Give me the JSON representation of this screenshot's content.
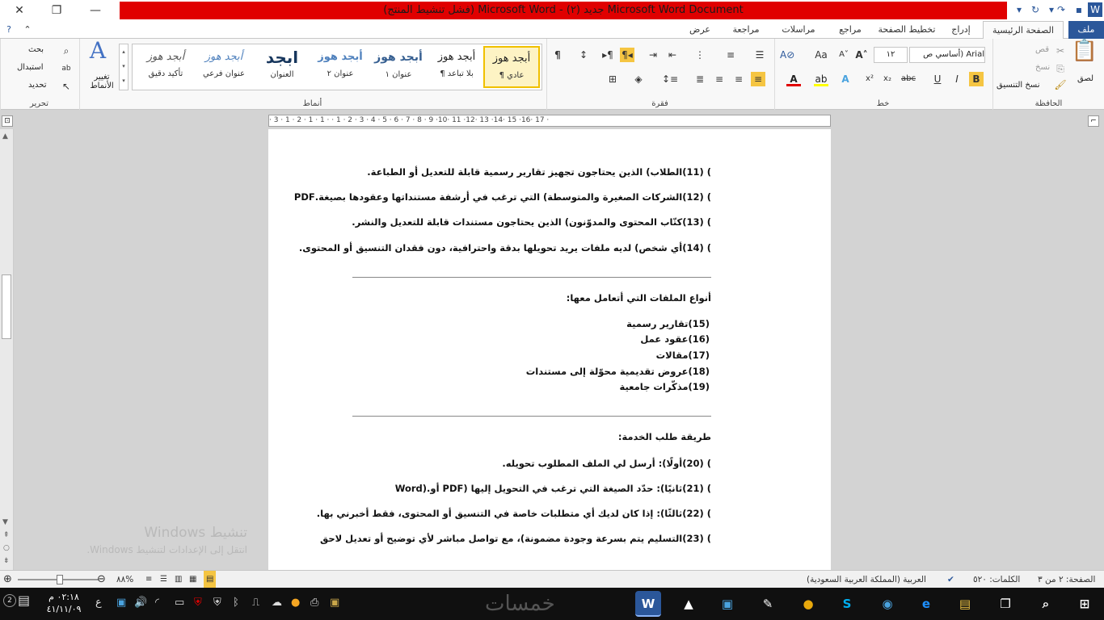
{
  "window": {
    "title": "Microsoft Word Document جديد (٢) - Microsoft Word (فشل تنشيط المنتج)"
  },
  "tabs": [
    "ملف",
    "الصفحة الرئيسية",
    "إدراج",
    "تخطيط الصفحة",
    "مراجع",
    "مراسلات",
    "مراجعة",
    "عرض"
  ],
  "ribbon": {
    "clipboard": {
      "label": "الحافظة",
      "paste": "لصق",
      "cut": "قص",
      "copy": "نسخ",
      "format_painter": "نسخ التنسيق"
    },
    "font": {
      "label": "خط",
      "name": "Arial (أساسي ص",
      "size": "١٢"
    },
    "paragraph": {
      "label": "فقرة"
    },
    "styles": {
      "label": "أنماط",
      "change_styles": "تغيير الأنماط",
      "sample": "أبجد هوز",
      "sample_title": "ابجد",
      "items": [
        "¶ عادي",
        "¶ بلا تباعد",
        "عنوان ١",
        "عنوان ٢",
        "العنوان",
        "عنوان فرعي",
        "تأكيد دقيق"
      ]
    },
    "editing": {
      "label": "تحرير",
      "find": "بحث",
      "replace": "استبدال",
      "select": "تحديد"
    }
  },
  "ruler": {
    "text": "· 3 · 1 · 2 · 1 · 1 ·   · 1 · 2 · 3 · 4 · 5 · 6 · 7 · 8 · 9 ·10· 11 ·12· 13 ·14· 15 ·16· 17 ·"
  },
  "document": {
    "paras_a": [
      ") (11)الطلاب) الذين يحتاجون تجهيز تقارير رسمية قابلة للتعديل أو الطباعة.",
      ") (12)الشركات الصغيرة والمتوسطة) التي ترغب في أرشفة مستنداتها وعقودها بصيغة.PDF",
      ") (13)كتّاب المحتوى والمدوّنون) الذين يحتاجون مستندات قابلة للتعديل والنشر.",
      ") (14)أي شخص) لديه ملفات يريد تحويلها بدقة واحترافية، دون فقدان التنسيق أو المحتوى."
    ],
    "heading_types": "أنواع الملفات التي أتعامل معها:",
    "types": [
      "(15)تقارير رسمية",
      "(16)عقود عمل",
      "(17)مقالات",
      "(18)عروض تقديمية محوّلة إلى مستندات",
      "(19)مذكّرات جامعية"
    ],
    "heading_request": "طريقة طلب الخدمة:",
    "paras_b": [
      ") (20)أولًا): أرسل لي الملف المطلوب تحويله.",
      ") (21)ثانيًا): حدّد الصيغة التي ترغب في التحويل إليها (PDF أو.(Word",
      ") (22)ثالثًا): إذا كان لديك أي متطلبات خاصة في التنسيق أو المحتوى، فقط أخبرني بها.",
      ") (23)التسليم يتم بسرعة وجودة مضمونة)، مع تواصل مباشر لأي توضيح أو تعديل لاحق"
    ]
  },
  "watermark": {
    "line1": "تنشيط Windows",
    "line2": "انتقل إلى الإعدادات لتنشيط Windows."
  },
  "status": {
    "page": "الصفحة: ٢ من ٣",
    "words": "الكلمات: ٥٢٠",
    "language": "العربية (المملكة العربية السعودية)",
    "zoom": "٨٨%"
  },
  "taskbar": {
    "time": "٠٢:١٨ م",
    "date": "٤١/١١/٠٩",
    "keyboard": "ع",
    "apps": [
      "W",
      "▲",
      "▣",
      "✎",
      "●",
      "S",
      "◉",
      "e",
      "▤",
      "❐",
      "⌕",
      "⊞"
    ],
    "watermark_logo": "خمسات"
  },
  "colors": {
    "brand": "#2b579a",
    "title_error": "#e00000"
  }
}
